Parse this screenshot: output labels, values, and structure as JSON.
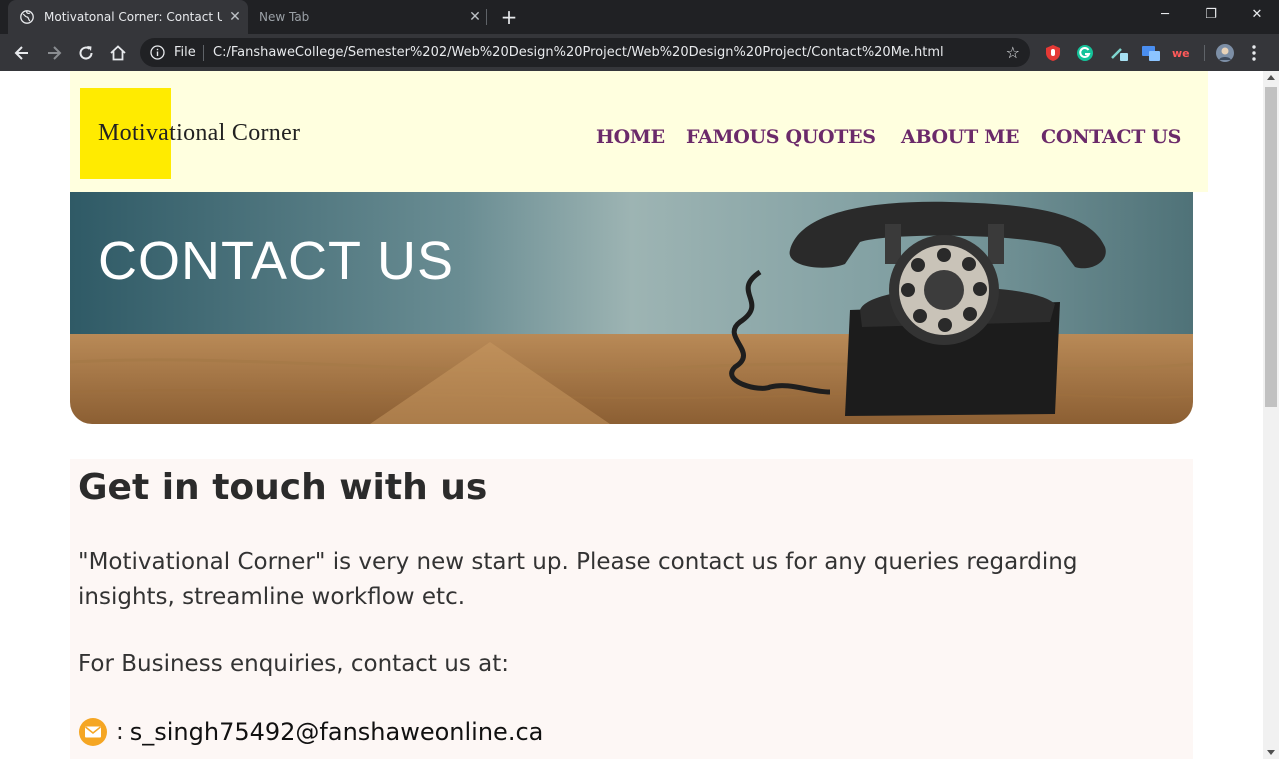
{
  "browser": {
    "active_tab_title": "Motivatonal Corner: Contact Us",
    "inactive_tab_title": "New Tab",
    "close_glyph": "✕",
    "new_tab_glyph": "+",
    "address_label": "File",
    "url": "C:/FanshaweCollege/Semester%202/Web%20Design%20Project/Web%20Design%20Project/Contact%20Me.html",
    "bookmark_glyph": "☆",
    "window_controls": {
      "minimize": "─",
      "restore": "❐",
      "close": "✕"
    },
    "icons": [
      "back-icon",
      "forward-icon",
      "reload-icon",
      "home-icon",
      "info-icon",
      "star-icon",
      "menu-icon"
    ]
  },
  "site": {
    "logo_text": "Motivational Corner",
    "nav": [
      "HOME",
      "FAMOUS QUOTES",
      "ABOUT ME",
      "CONTACT US"
    ],
    "banner_title": "CONTACT US",
    "heading": "Get in touch with us",
    "paragraph": "\"Motivational Corner\" is very new start up. Please contact us for any queries regarding insights, streamline workflow etc.",
    "business_line": "For Business enquiries, contact us at:",
    "email_separator": ":",
    "email": "s_singh75492@fanshaweonline.ca"
  },
  "colors": {
    "header_bg": "#ffffdf",
    "logo_yellow": "#ffeb00",
    "nav_text": "#6b2a6a",
    "content_bg": "#fdf7f5"
  }
}
